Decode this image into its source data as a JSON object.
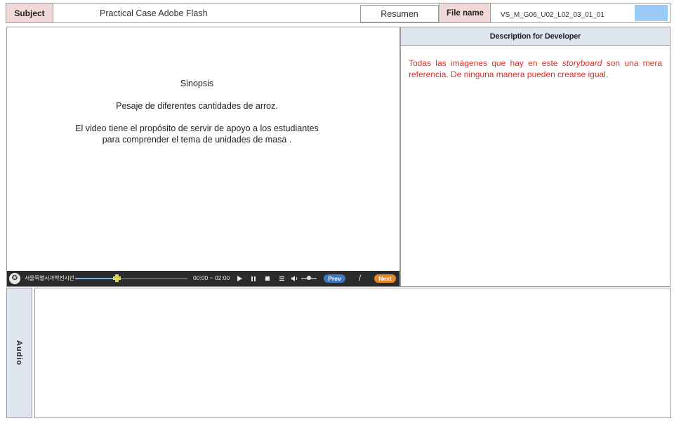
{
  "header": {
    "subject_label": "Subject",
    "subject_value": "Practical Case Adobe Flash",
    "resumen_label": "Resumen",
    "file_label": "File name",
    "file_value": "VS_M_G06_U02_L02_03_01_01",
    "swatch_color": "#9ccbf6"
  },
  "stage": {
    "synopsis_title": "Sinopsis",
    "line1": "Pesaje de diferentes cantidades de arroz.",
    "line2": "El video tiene el propósito de servir de apoyo a los estudiantes",
    "line3": "para comprender  el tema de unidades de masa ."
  },
  "player": {
    "brand": "서울특별시과학전시관",
    "time": "00:00 ~ 02:00",
    "progress": 0.37,
    "prev_label": "Prev",
    "separator": "/",
    "next_label": "Next",
    "icons": [
      "logo-icon",
      "play-icon",
      "pause-icon",
      "stop-icon",
      "menu-icon",
      "volume-icon"
    ]
  },
  "developer": {
    "heading": "Description for Developer",
    "note_part1": "Todas las imágenes que hay en este ",
    "note_italic": "storyboard",
    "note_part2": " son una mera referencia. De ninguna manera pueden crearse igual."
  },
  "audio": {
    "label": "Audio"
  }
}
